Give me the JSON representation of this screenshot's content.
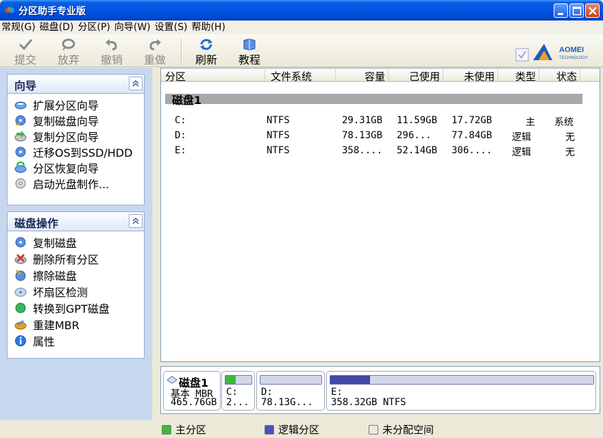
{
  "window": {
    "title": "分区助手专业版"
  },
  "menu": [
    {
      "label": "常规(G)"
    },
    {
      "label": "磁盘(D)"
    },
    {
      "label": "分区(P)"
    },
    {
      "label": "向导(W)"
    },
    {
      "label": "设置(S)"
    },
    {
      "label": "帮助(H)"
    }
  ],
  "toolbar": {
    "commit": "提交",
    "discard": "放弃",
    "undo": "撤销",
    "redo": "重做",
    "refresh": "刷新",
    "tutorial": "教程"
  },
  "logo": {
    "brand": "AOMEI",
    "sub": "TECHNOLOGY"
  },
  "wizard": {
    "title": "向导",
    "items": [
      {
        "label": "扩展分区向导"
      },
      {
        "label": "复制磁盘向导"
      },
      {
        "label": "复制分区向导"
      },
      {
        "label": "迁移OS到SSD/HDD"
      },
      {
        "label": "分区恢复向导"
      },
      {
        "label": "启动光盘制作..."
      }
    ]
  },
  "diskops": {
    "title": "磁盘操作",
    "items": [
      {
        "label": "复制磁盘"
      },
      {
        "label": "删除所有分区"
      },
      {
        "label": "擦除磁盘"
      },
      {
        "label": "坏扇区检测"
      },
      {
        "label": "转换到GPT磁盘"
      },
      {
        "label": "重建MBR"
      },
      {
        "label": "属性"
      }
    ]
  },
  "table": {
    "headers": [
      "分区",
      "文件系统",
      "容量",
      "己使用",
      "未使用",
      "类型",
      "状态"
    ],
    "disk_label": "磁盘1",
    "rows": [
      {
        "partition": "C:",
        "fs": "NTFS",
        "capacity": "29.31GB",
        "used": "11.59GB",
        "free": "17.72GB",
        "type": "主",
        "status": "系统"
      },
      {
        "partition": "D:",
        "fs": "NTFS",
        "capacity": "78.13GB",
        "used": "296...",
        "free": "77.84GB",
        "type": "逻辑",
        "status": "无"
      },
      {
        "partition": "E:",
        "fs": "NTFS",
        "capacity": "358....",
        "used": "52.14GB",
        "free": "306....",
        "type": "逻辑",
        "status": "无"
      }
    ]
  },
  "diskmap": {
    "disk_name": "磁盘1",
    "disk_type": "基本 MBR",
    "disk_size": "465.76GB",
    "parts": [
      {
        "label": "C:",
        "info": "2...",
        "used_fraction": 0.4,
        "color": "#3cb83c"
      },
      {
        "label": "D:",
        "info": "78.13G...",
        "used_fraction": 0.0,
        "color": "#5058b8"
      },
      {
        "label": "E:",
        "info": "358.32GB NTFS",
        "used_fraction": 0.15,
        "color": "#4048a8"
      }
    ]
  },
  "legend": {
    "primary": "主分区",
    "logical": "逻辑分区",
    "unallocated": "未分配空间",
    "colors": {
      "primary": "#3cb83c",
      "logical": "#4a4fc0",
      "unallocated": "#f1e6dc"
    }
  }
}
